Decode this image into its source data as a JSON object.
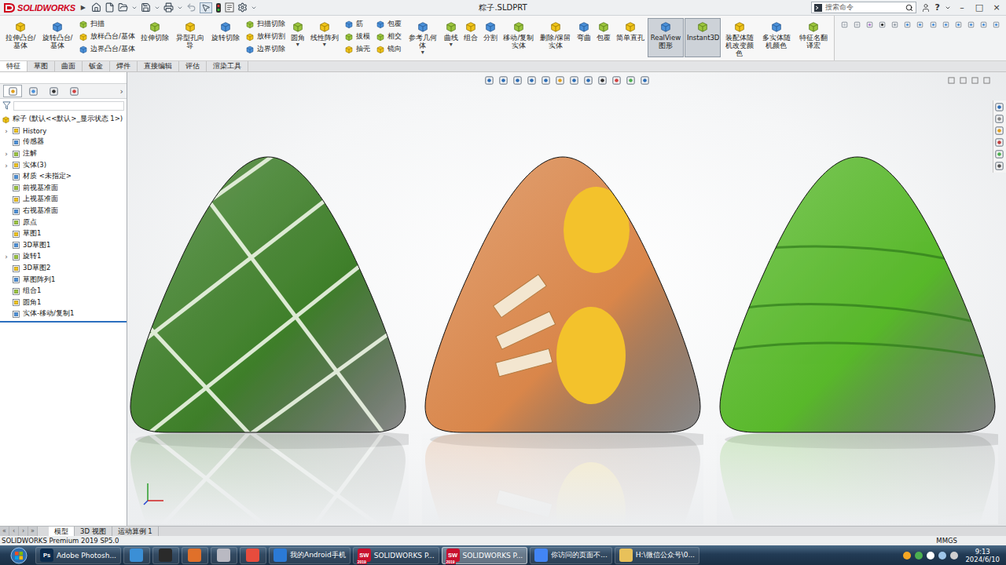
{
  "app": {
    "logo": "SOLIDWORKS",
    "menu_arrow": "▶"
  },
  "window": {
    "title": "粽子.SLDPRT",
    "help": "?",
    "controls": [
      "–",
      "□",
      "×"
    ]
  },
  "search": {
    "placeholder": "搜索命令"
  },
  "ribbon": {
    "dropdown_glyph": "▾",
    "groups": [
      {
        "kind": "large",
        "label": "拉伸凸台/基体",
        "pressed": false,
        "dropdown": false
      },
      {
        "kind": "large",
        "label": "旋转凸台/基体",
        "pressed": false,
        "dropdown": false
      },
      {
        "kind": "stack",
        "items": [
          "扫描",
          "放样凸台/基体",
          "边界凸台/基体"
        ]
      },
      {
        "kind": "large",
        "label": "拉伸切除",
        "pressed": false,
        "dropdown": false
      },
      {
        "kind": "large",
        "label": "异型孔向导",
        "pressed": false,
        "dropdown": false
      },
      {
        "kind": "large",
        "label": "旋转切除",
        "pressed": false,
        "dropdown": false
      },
      {
        "kind": "stack",
        "items": [
          "扫描切除",
          "放样切割",
          "边界切除"
        ]
      },
      {
        "kind": "large",
        "label": "圆角",
        "pressed": false,
        "dropdown": true
      },
      {
        "kind": "large",
        "label": "线性阵列",
        "pressed": false,
        "dropdown": true
      },
      {
        "kind": "stack",
        "items": [
          "筋",
          "拔模",
          "抽壳"
        ]
      },
      {
        "kind": "stack",
        "items": [
          "包覆",
          "相交",
          "镜向"
        ]
      },
      {
        "kind": "large",
        "label": "参考几何体",
        "pressed": false,
        "dropdown": true
      },
      {
        "kind": "large",
        "label": "曲线",
        "pressed": false,
        "dropdown": true
      },
      {
        "kind": "large",
        "label": "组合",
        "pressed": false,
        "dropdown": false
      },
      {
        "kind": "large",
        "label": "分割",
        "pressed": false,
        "dropdown": false
      },
      {
        "kind": "large",
        "label": "移动/复制实体",
        "pressed": false,
        "dropdown": false
      },
      {
        "kind": "large",
        "label": "删除/保留实体",
        "pressed": false,
        "dropdown": false
      },
      {
        "kind": "large",
        "label": "弯曲",
        "pressed": false,
        "dropdown": false
      },
      {
        "kind": "large",
        "label": "包覆",
        "pressed": false,
        "dropdown": false
      },
      {
        "kind": "large",
        "label": "简单直孔",
        "pressed": false,
        "dropdown": false
      },
      {
        "kind": "large",
        "label": "RealView图形",
        "pressed": true,
        "dropdown": false
      },
      {
        "kind": "large",
        "label": "Instant3D",
        "pressed": true,
        "dropdown": false
      },
      {
        "kind": "large",
        "label": "装配体随机改变颜色",
        "pressed": false,
        "dropdown": false
      },
      {
        "kind": "large",
        "label": "多实体随机颜色",
        "pressed": false,
        "dropdown": false
      },
      {
        "kind": "large",
        "label": "特征名翻译宏",
        "pressed": false,
        "dropdown": false
      }
    ]
  },
  "command_tabs": [
    {
      "label": "特征",
      "selected": true
    },
    {
      "label": "草图",
      "selected": false
    },
    {
      "label": "曲面",
      "selected": false
    },
    {
      "label": "钣金",
      "selected": false
    },
    {
      "label": "焊件",
      "selected": false
    },
    {
      "label": "直接编辑",
      "selected": false
    },
    {
      "label": "评估",
      "selected": false
    },
    {
      "label": "渲染工具",
      "selected": false
    }
  ],
  "feature_tree": {
    "tabs_more": "›",
    "collapsed_glyph": "›",
    "panel_tabs": [
      {
        "selected": true
      },
      {
        "selected": false
      },
      {
        "selected": false
      },
      {
        "selected": false
      }
    ],
    "root": "粽子  (默认<<默认>_显示状态 1>)",
    "items": [
      {
        "label": "History",
        "expandable": true,
        "expanded": false
      },
      {
        "label": "传感器",
        "expandable": false,
        "expanded": false
      },
      {
        "label": "注解",
        "expandable": true,
        "expanded": false
      },
      {
        "label": "实体(3)",
        "expandable": true,
        "expanded": false
      },
      {
        "label": "材质 <未指定>",
        "expandable": false,
        "expanded": false
      },
      {
        "label": "前视基准面",
        "expandable": false,
        "expanded": false
      },
      {
        "label": "上视基准面",
        "expandable": false,
        "expanded": false
      },
      {
        "label": "右视基准面",
        "expandable": false,
        "expanded": false
      },
      {
        "label": "原点",
        "expandable": false,
        "expanded": false
      },
      {
        "label": "草图1",
        "expandable": false,
        "expanded": false
      },
      {
        "label": "3D草图1",
        "expandable": false,
        "expanded": false
      },
      {
        "label": "旋转1",
        "expandable": true,
        "expanded": false
      },
      {
        "label": "3D草图2",
        "expandable": false,
        "expanded": false
      },
      {
        "label": "草图阵列1",
        "expandable": false,
        "expanded": false
      },
      {
        "label": "组合1",
        "expandable": false,
        "expanded": false
      },
      {
        "label": "圆角1",
        "expandable": false,
        "expanded": false
      },
      {
        "label": "实体-移动/复制1",
        "expandable": false,
        "expanded": false
      }
    ]
  },
  "viewport": {
    "models": [
      {
        "kind": "leaf-striped",
        "color": "#3f7f2a",
        "accent": "#eef5e6"
      },
      {
        "kind": "filling",
        "color": "#d9864a",
        "accent": "#f3c22c"
      },
      {
        "kind": "leaf-plain",
        "color": "#58b82a",
        "accent": "#2f7a1c"
      }
    ]
  },
  "bottom_tabs": {
    "nav": [
      "«",
      "‹",
      "›",
      "»"
    ],
    "tabs": [
      {
        "label": "模型",
        "selected": true
      },
      {
        "label": "3D 视图",
        "selected": false
      },
      {
        "label": "运动算例 1",
        "selected": false
      }
    ]
  },
  "status_bar": {
    "product": "SOLIDWORKS Premium 2019 SP5.0",
    "units": "MMGS"
  },
  "taskbar": {
    "time": "9:13",
    "date": "2024/6/10",
    "items": [
      {
        "kind": "window",
        "label": "Adobe Photosh...",
        "icon_text": "Ps",
        "color": "#0b2b4d",
        "active": false
      },
      {
        "kind": "pinned",
        "color": "#3b8fd6",
        "active": false
      },
      {
        "kind": "pinned",
        "color": "#2a2a2a",
        "active": false
      },
      {
        "kind": "pinned",
        "color": "#e0702a",
        "active": false
      },
      {
        "kind": "pinned",
        "color": "#b9b9c2",
        "active": false
      },
      {
        "kind": "pinned",
        "color": "#e84c3d",
        "active": false
      },
      {
        "kind": "window",
        "label": "我的Android手机",
        "color": "#2b7ad6",
        "active": false
      },
      {
        "kind": "window",
        "label": "SOLIDWORKS P...",
        "icon_text": "SW",
        "badge": "2019",
        "color": "#c8102e",
        "active": false
      },
      {
        "kind": "window",
        "label": "SOLIDWORKS P...",
        "icon_text": "SW",
        "badge": "2019",
        "color": "#c8102e",
        "active": true
      },
      {
        "kind": "window",
        "label": "你访问的页面不...",
        "color": "#4285f4",
        "active": false
      },
      {
        "kind": "window",
        "label": "H:\\微信公众号\\0...",
        "color": "#e8c15a",
        "active": false
      }
    ]
  }
}
